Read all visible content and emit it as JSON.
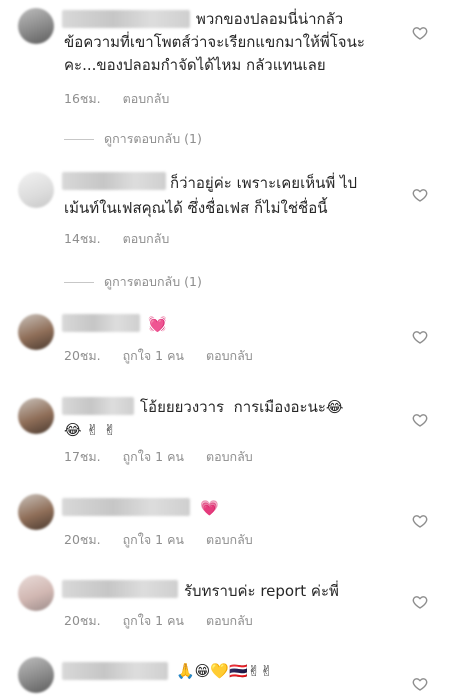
{
  "comments": [
    {
      "text": "พวกของปลอมนี่น่ากลัว ข้อความที่เขาโพตส์ว่าจะเรียกแขกมาให้พี่โจนะคะ...ของปลอมกำจัดได้ไหม กลัวแทนเลย",
      "line1": "พวกของปลอมนี่น่ากลัว",
      "line2": "ข้อความที่เขาโพตส์ว่าจะเรียกแขกมาให้พี่โจนะ",
      "line3": "คะ...ของปลอมกำจัดได้ไหม กลัวแทนเลย",
      "time": "16ชม.",
      "reply": "ตอบกลับ",
      "view_replies": "ดูการตอบกลับ (1)"
    },
    {
      "line1": "ก็ว่าอยู่ค่ะ เพราะเคยเห็นพี่ ไป",
      "line2": "เม้นท์ในเฟสคุณได้ ซึ่งชื่อเฟส ก็ไม่ใช่ชื่อนี้",
      "time": "14ชม.",
      "reply": "ตอบกลับ",
      "view_replies": "ดูการตอบกลับ (1)"
    },
    {
      "emoji": "💓",
      "time": "20ชม.",
      "likes": "ถูกใจ 1 คน",
      "reply": "ตอบกลับ"
    },
    {
      "line1": "โอ้ยยยวงวาร  การเมืองอะนะ😂",
      "line2": "😂 ✌ ✌",
      "time": "17ชม.",
      "likes": "ถูกใจ 1 คน",
      "reply": "ตอบกลับ"
    },
    {
      "emoji": "💗",
      "time": "20ชม.",
      "likes": "ถูกใจ 1 คน",
      "reply": "ตอบกลับ"
    },
    {
      "line1": "รับทราบค่ะ report ค่ะพี่",
      "time": "20ชม.",
      "likes": "ถูกใจ 1 คน",
      "reply": "ตอบกลับ"
    },
    {
      "emoji": "🙏😁💛🇹🇭✌✌"
    }
  ]
}
